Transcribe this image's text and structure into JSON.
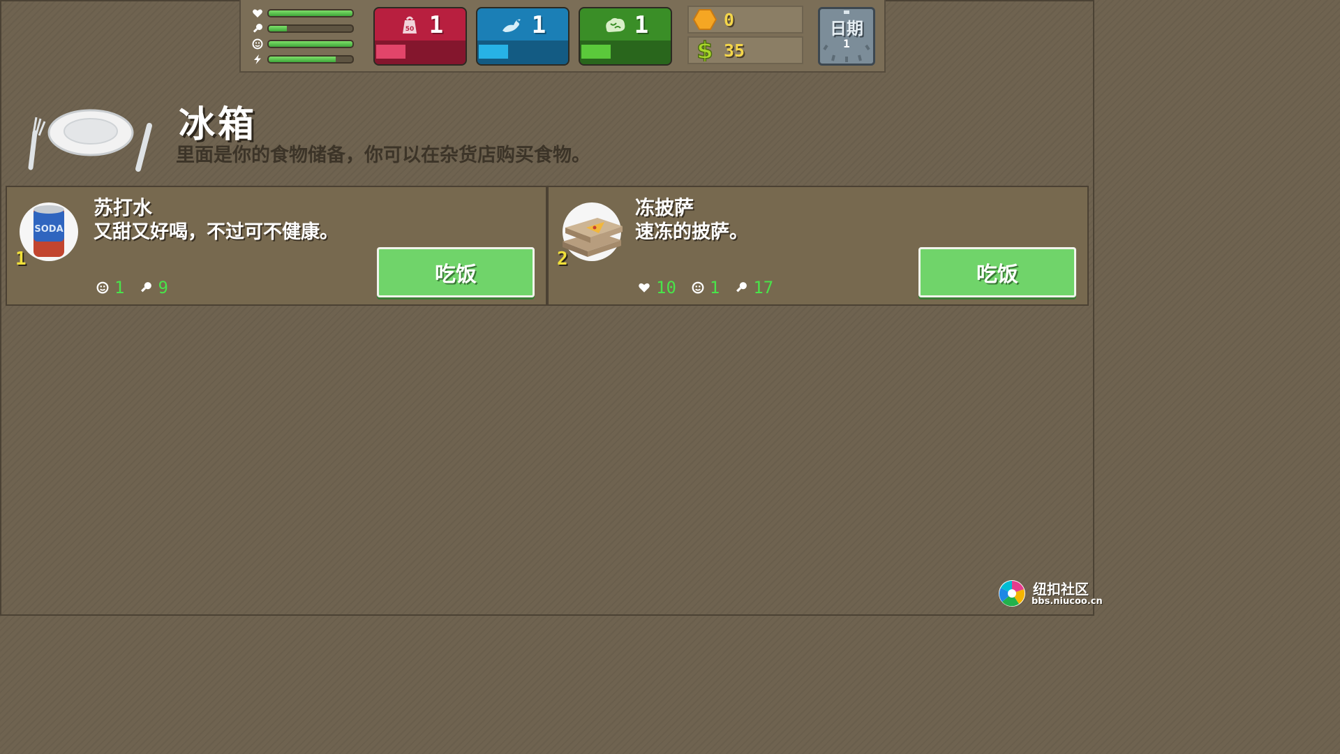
{
  "hud": {
    "stats": [
      {
        "name": "health",
        "icon": "heart-icon",
        "level": 1.0
      },
      {
        "name": "hunger",
        "icon": "drumstick-icon",
        "level": 0.22
      },
      {
        "name": "mood",
        "icon": "smiley-icon",
        "level": 1.0
      },
      {
        "name": "energy",
        "icon": "lightning-icon",
        "level": 0.8
      }
    ],
    "skills": [
      {
        "name": "strength",
        "icon": "weight-icon",
        "value": "1",
        "progress": 0.33,
        "color": "#b81f3f",
        "bar_color": "#e2456a"
      },
      {
        "name": "charm",
        "icon": "bird-icon",
        "value": "1",
        "progress": 0.33,
        "color": "#1b7fb6",
        "bar_color": "#27b2e6"
      },
      {
        "name": "intelligence",
        "icon": "brain-icon",
        "value": "1",
        "progress": 0.33,
        "color": "#3a8e27",
        "bar_color": "#5bc93b"
      }
    ],
    "coins": {
      "icon": "coin-icon",
      "value": "0"
    },
    "cash": {
      "icon": "dollar-icon",
      "value": "35"
    },
    "date": {
      "label": "日期",
      "value": "1",
      "icon": "calendar-icon"
    }
  },
  "header": {
    "icon": "plate-cutlery-icon",
    "title": "冰箱",
    "subtitle": "里面是你的食物储备，你可以在杂货店购买食物。"
  },
  "items": [
    {
      "name": "苏打水",
      "desc": "又甜又好喝，不过可不健康。",
      "qty": "1",
      "icon": "soda-can-icon",
      "stats": [
        {
          "icon": "smiley-icon",
          "value": "1"
        },
        {
          "icon": "drumstick-icon",
          "value": "9"
        }
      ],
      "button": "吃饭"
    },
    {
      "name": "冻披萨",
      "desc": "速冻的披萨。",
      "qty": "2",
      "icon": "pizza-box-icon",
      "stats": [
        {
          "icon": "heart-icon",
          "value": "10"
        },
        {
          "icon": "smiley-icon",
          "value": "1"
        },
        {
          "icon": "drumstick-icon",
          "value": "17"
        }
      ],
      "button": "吃饭"
    }
  ],
  "watermark": {
    "name": "纽扣社区",
    "url": "bbs.niucoo.cn"
  }
}
